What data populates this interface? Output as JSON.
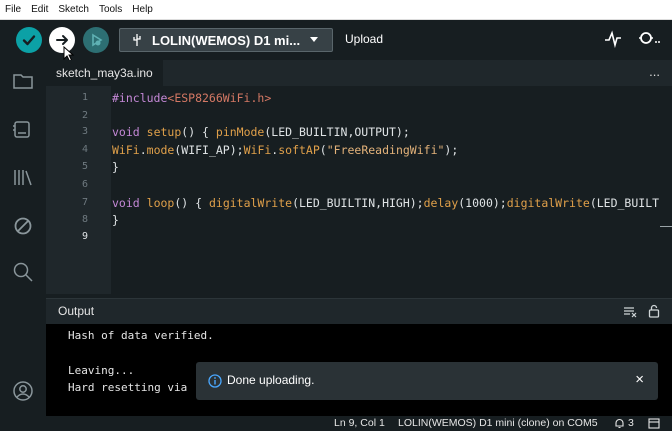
{
  "menu": [
    "File",
    "Edit",
    "Sketch",
    "Tools",
    "Help"
  ],
  "toolbar": {
    "board": "LOLIN(WEMOS) D1 mi...",
    "upload_label": "Upload",
    "verify_icon": "check-icon",
    "upload_icon": "arrow-right-icon",
    "debug_icon": "debug-icon",
    "serial_plotter_icon": "pulse-icon",
    "serial_monitor_icon": "magnifier-icon"
  },
  "tab": {
    "name": "sketch_may3a.ino",
    "more": "..."
  },
  "editor": {
    "line_numbers": [
      "1",
      "2",
      "3",
      "4",
      "5",
      "6",
      "7",
      "8",
      "9"
    ],
    "active_line": 9
  },
  "code": {
    "l1_kw": "#include",
    "l1_file": "<ESP8266WiFi.h>",
    "l3_void": "void",
    "l3_fn": "setup",
    "l3_mid": "() { ",
    "l3_call": "pinMode",
    "l3_args": "(LED_BUILTIN,OUTPUT);",
    "l4_obj1": "WiFi",
    "l4_dot1": ".",
    "l4_mode": "mode",
    "l4_args1": "(WIFI_AP);",
    "l4_obj2": "WiFi",
    "l4_dot2": ".",
    "l4_soft": "softAP",
    "l4_open": "(",
    "l4_str": "\"FreeReadingWifi\"",
    "l4_close": ");",
    "l5": "}",
    "l7_void": "void",
    "l7_fn": "loop",
    "l7_mid": "() { ",
    "l7_dw": "digitalWrite",
    "l7_args1": "(LED_BUILTIN,HIGH);",
    "l7_delay": "delay",
    "l7_args2": "(1000);",
    "l7_dw2": "digitalWrite",
    "l7_args3": "(LED_BUILT",
    "l8": "}"
  },
  "output": {
    "title": "Output",
    "lines": [
      "Hash of data verified.",
      "",
      "Leaving...",
      "Hard resetting via"
    ]
  },
  "toast": {
    "message": "Done uploading.",
    "close": "×"
  },
  "status": {
    "position": "Ln 9, Col 1",
    "board": "LOLIN(WEMOS) D1 mini (clone) on COM5",
    "notifications": "3"
  },
  "colors": {
    "accent": "#0ca1a6",
    "background": "#171e21"
  }
}
